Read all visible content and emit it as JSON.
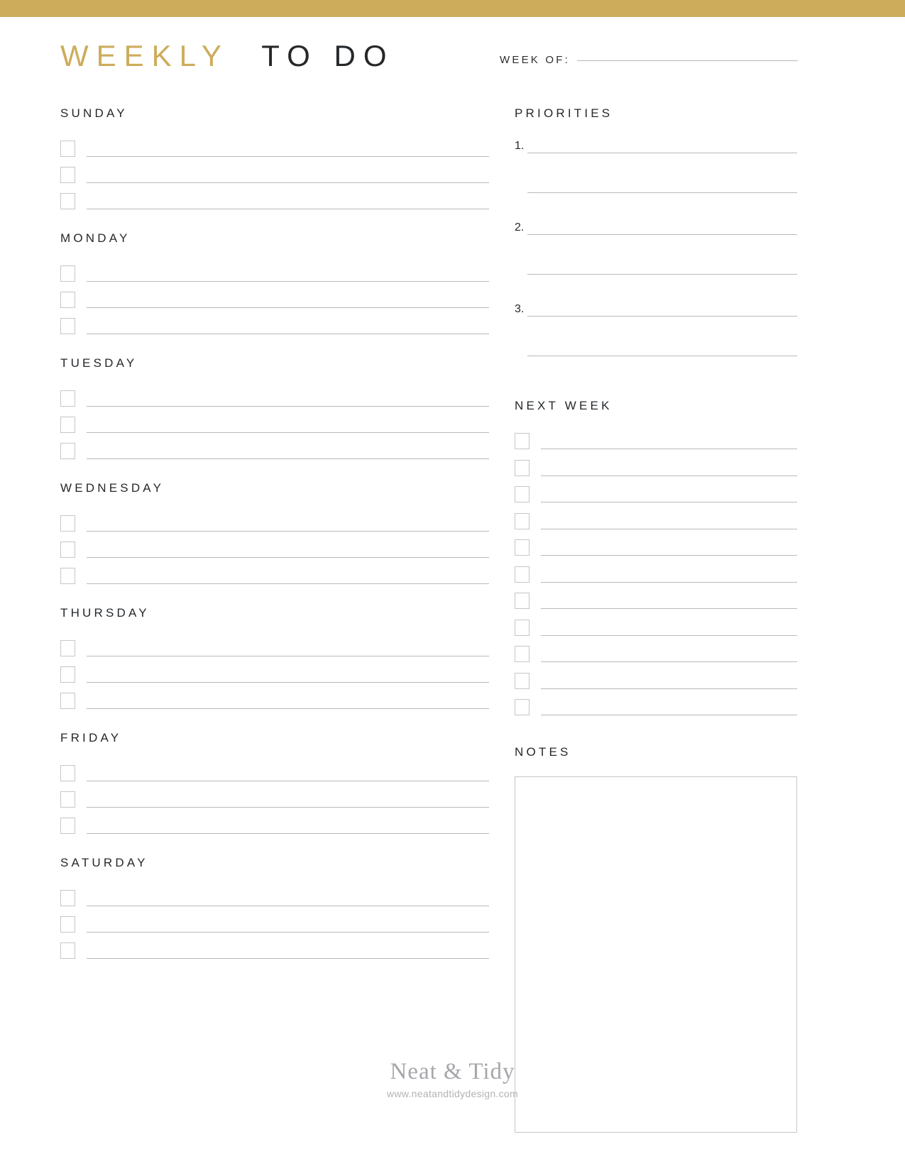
{
  "theme": {
    "gold": "#cdac5b",
    "ink": "#25282b",
    "rule": "#b9b9bb",
    "box_border": "#c6c6c8",
    "footer_gray": "#a9a6ab"
  },
  "header": {
    "title_gold": "WEEKLY",
    "title_dark": "TO DO",
    "week_of_label": "WEEK OF:"
  },
  "days": [
    {
      "name": "SUNDAY",
      "rows": 3
    },
    {
      "name": "MONDAY",
      "rows": 3
    },
    {
      "name": "TUESDAY",
      "rows": 3
    },
    {
      "name": "WEDNESDAY",
      "rows": 3
    },
    {
      "name": "THURSDAY",
      "rows": 3
    },
    {
      "name": "FRIDAY",
      "rows": 3
    },
    {
      "name": "SATURDAY",
      "rows": 3
    }
  ],
  "priorities": {
    "heading": "PRIORITIES",
    "items": [
      {
        "number": "1."
      },
      {
        "number": "2."
      },
      {
        "number": "3."
      }
    ]
  },
  "next_week": {
    "heading": "NEXT WEEK",
    "rows": 11
  },
  "notes": {
    "heading": "NOTES"
  },
  "footer": {
    "brand": "Neat & Tidy",
    "url": "www.neatandtidydesign.com"
  }
}
